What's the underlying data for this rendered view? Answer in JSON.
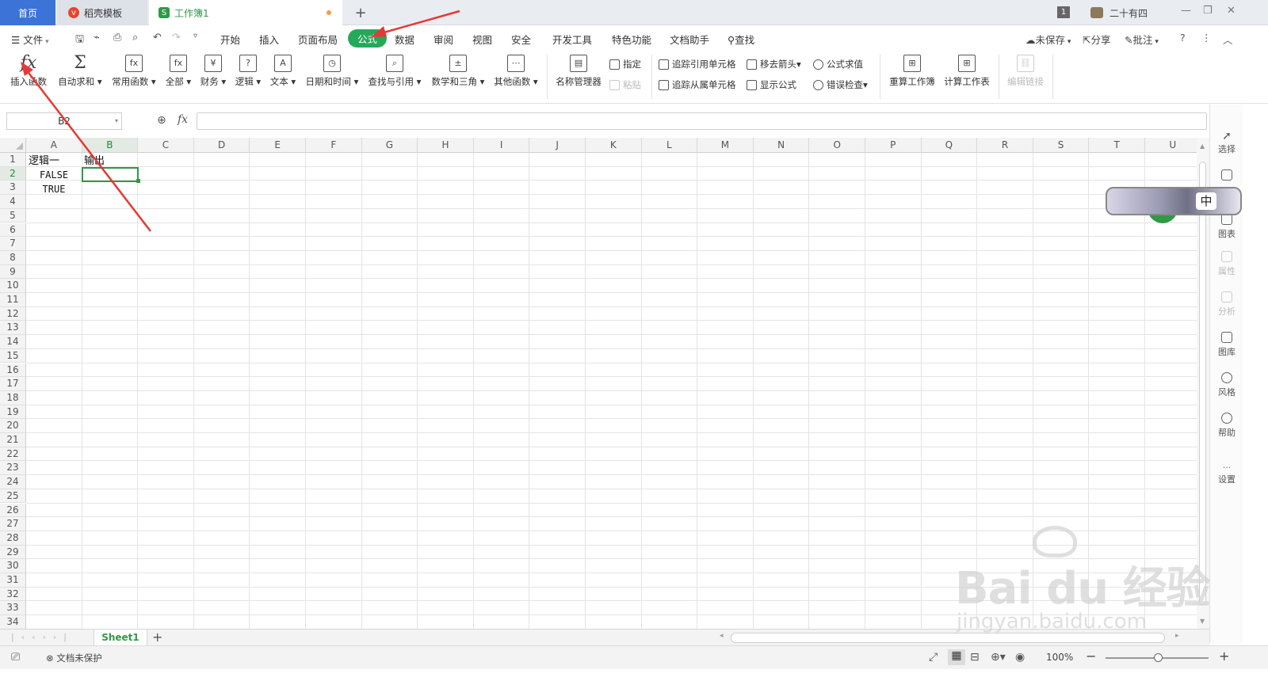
{
  "tabs": {
    "home": "首页",
    "template": "稻壳模板",
    "workbook": "工作簿1",
    "add": "+"
  },
  "window": {
    "badge": "1",
    "user": "二十有四"
  },
  "menus": [
    "文件",
    "开始",
    "插入",
    "页面布局",
    "公式",
    "数据",
    "审阅",
    "视图",
    "安全",
    "开发工具",
    "特色功能",
    "文档助手",
    "查找"
  ],
  "menu_right": {
    "unsaved": "未保存",
    "share": "分享",
    "comment": "批注"
  },
  "ribbon": {
    "insert_fn": "插入函数",
    "autosum": "自动求和",
    "common_fn": "常用函数",
    "all": "全部",
    "finance": "财务",
    "logic": "逻辑",
    "text": "文本",
    "datetime": "日期和时间",
    "lookup": "查找与引用",
    "math": "数学和三角",
    "other_fn": "其他函数",
    "name_mgr": "名称管理器",
    "assign": "指定",
    "paste": "粘贴",
    "trace_prec": "追踪引用单元格",
    "trace_dep": "追踪从属单元格",
    "remove_arrows": "移去箭头",
    "show_formula": "显示公式",
    "eval_formula": "公式求值",
    "error_check": "错误检查",
    "recalc_book": "重算工作簿",
    "calc_sheet": "计算工作表",
    "edit_links": "编辑链接"
  },
  "namebox": "B2",
  "fx": "fx",
  "columns": [
    "A",
    "B",
    "C",
    "D",
    "E",
    "F",
    "G",
    "H",
    "I",
    "J",
    "K",
    "L",
    "M",
    "N",
    "O",
    "P",
    "Q",
    "R",
    "S",
    "T",
    "U"
  ],
  "rows": [
    "1",
    "2",
    "3",
    "4",
    "5",
    "6",
    "7",
    "8",
    "9",
    "10",
    "11",
    "12",
    "13",
    "14",
    "15",
    "16",
    "17",
    "18",
    "19",
    "20",
    "21",
    "22",
    "23",
    "24",
    "25",
    "26",
    "27",
    "28",
    "29",
    "30",
    "31",
    "32",
    "33",
    "34"
  ],
  "cells": {
    "A1": "逻辑一",
    "B1": "输出",
    "A2": "FALSE",
    "A3": "TRUE"
  },
  "right_panel": [
    "选择",
    "图表",
    "属性",
    "分析",
    "图库",
    "风格",
    "帮助",
    "设置"
  ],
  "sheet": {
    "name": "Sheet1",
    "add": "+"
  },
  "status": {
    "protect": "文档未保护",
    "zoom": "100%"
  },
  "widget": {
    "label": "中"
  },
  "watermark": {
    "main": "Bai du 经验",
    "sub": "jingyan.baidu.com"
  }
}
